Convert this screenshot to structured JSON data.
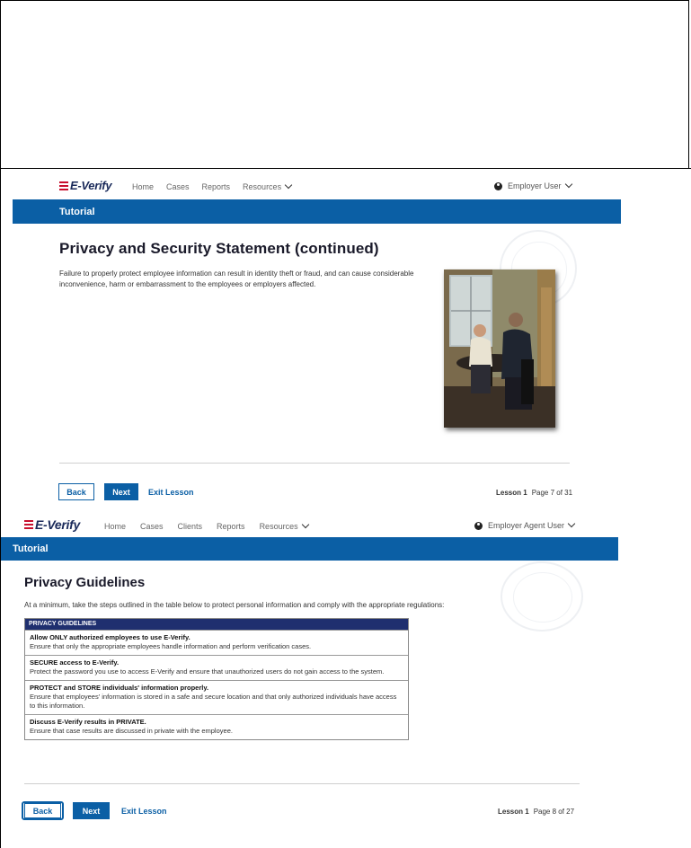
{
  "screen1": {
    "logo_text": "E-Verify",
    "nav": [
      "Home",
      "Cases",
      "Reports",
      "Resources"
    ],
    "user": "Employer User",
    "bar_title": "Tutorial",
    "title": "Privacy and Security Statement (continued)",
    "body": "Failure to properly protect employee information can result in identity theft or fraud, and can cause considerable inconvenience, harm or embarrassment to the employees or employers affected.",
    "back_label": "Back",
    "next_label": "Next",
    "exit_label": "Exit Lesson",
    "lesson_label": "Lesson 1",
    "page_label": "Page 7 of 31"
  },
  "screen2": {
    "logo_text": "E-Verify",
    "nav": [
      "Home",
      "Cases",
      "Clients",
      "Reports",
      "Resources"
    ],
    "user": "Employer Agent User",
    "bar_title": "Tutorial",
    "title": "Privacy Guidelines",
    "intro": "At a minimum, take the steps outlined in the table below to protect personal information and comply with the appropriate regulations:",
    "table_header": "PRIVACY GUIDELINES",
    "rows": [
      {
        "title": "Allow ONLY authorized employees to use E-Verify.",
        "desc": "Ensure that only the appropriate employees handle information and perform verification cases."
      },
      {
        "title": "SECURE access to E-Verify.",
        "desc": "Protect the password you use to access E-Verify and ensure that unauthorized users do not gain access to the system."
      },
      {
        "title": "PROTECT and STORE individuals' information properly.",
        "desc": "Ensure that employees' information is stored in a safe and secure location and that only authorized individuals have access to this information."
      },
      {
        "title": "Discuss E-Verify results in PRIVATE.",
        "desc": "Ensure that case results are discussed in private with the employee."
      }
    ],
    "back_label": "Back",
    "next_label": "Next",
    "exit_label": "Exit Lesson",
    "lesson_label": "Lesson 1",
    "page_label": "Page 8 of 27"
  },
  "colors": {
    "brand_blue": "#0b5fa5",
    "table_header": "#1f2f6f",
    "logo_red": "#c8102e"
  }
}
